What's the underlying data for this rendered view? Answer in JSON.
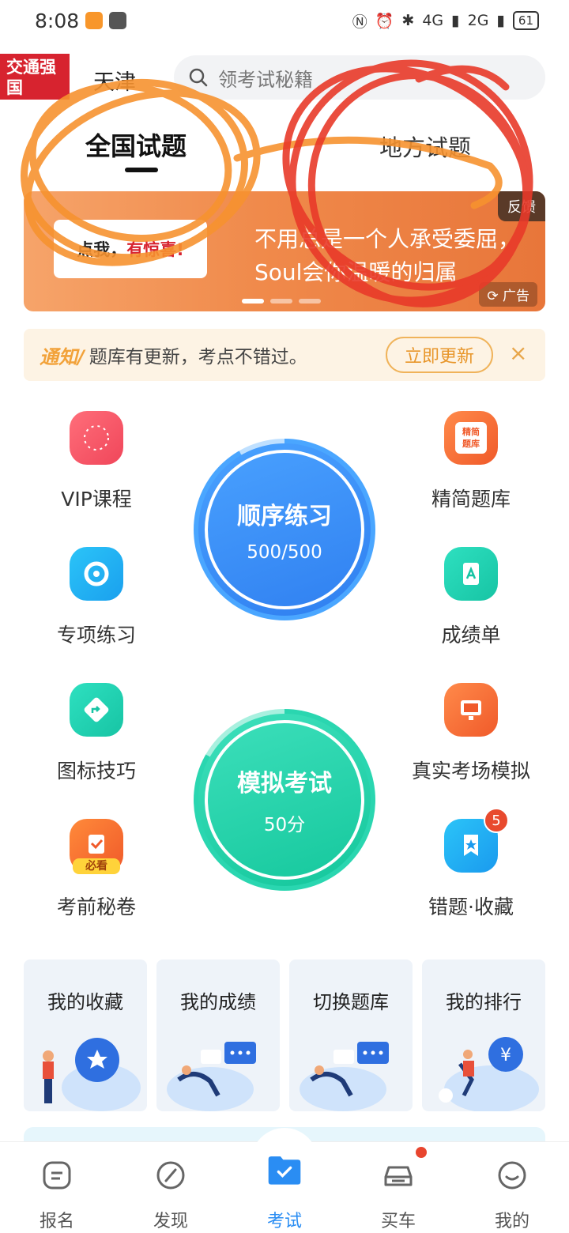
{
  "status_bar": {
    "time": "8:08",
    "network_1": "4G",
    "network_2": "2G",
    "battery": "61"
  },
  "header": {
    "brand": "交通强国",
    "city": "天津",
    "search_placeholder": "领考试秘籍"
  },
  "tabs": [
    {
      "label": "全国试题"
    },
    {
      "label": "地方试题"
    }
  ],
  "banner": {
    "card_text": "点我，",
    "card_highlight": "有惊喜!",
    "text": "不用总是一个人承受委屈，Soul会你温暖的归属",
    "feedback": "反馈",
    "ad_label": "广告"
  },
  "notice": {
    "tag": "通知/",
    "text": "题库有更新，考点不错过。",
    "button": "立即更新"
  },
  "functions": {
    "vip": "VIP课程",
    "special": "专项练习",
    "icon_tips": "图标技巧",
    "secret": "考前秘卷",
    "secret_tag": "必看",
    "concise": "精简题库",
    "concise_icon": "精简题库",
    "report": "成绩单",
    "real_sim": "真实考场模拟",
    "mistakes": "错题·收藏",
    "mistakes_badge": "5"
  },
  "practice": {
    "title": "顺序练习",
    "progress": "500/500"
  },
  "exam": {
    "title": "模拟考试",
    "score": "50分"
  },
  "cards": [
    {
      "label": "我的收藏"
    },
    {
      "label": "我的成绩"
    },
    {
      "label": "切换题库"
    },
    {
      "label": "我的排行"
    }
  ],
  "nav": [
    {
      "label": "报名"
    },
    {
      "label": "发现"
    },
    {
      "label": "考试"
    },
    {
      "label": "买车"
    },
    {
      "label": "我的"
    }
  ],
  "colors": {
    "accent": "#2a8df3",
    "practice_blue": "#3a8ef5",
    "exam_green": "#1dcfa4",
    "annotation_orange": "#f7922f",
    "annotation_red": "#e83a2a"
  }
}
